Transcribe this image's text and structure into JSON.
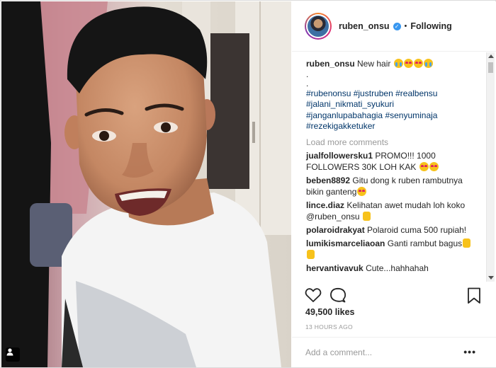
{
  "header": {
    "username": "ruben_onsu",
    "separator": "•",
    "follow_status": "Following",
    "verified_glyph": "✓"
  },
  "caption": {
    "username": "ruben_onsu",
    "text": "New hair",
    "emojis": [
      "crying-face",
      "heart-eyes-face",
      "heart-eyes-face",
      "crying-face"
    ],
    "dot_lines": [
      ".",
      "."
    ],
    "hashtags_line1": "#rubenonsu #justruben #realbensu",
    "hashtags_line2": "#jalani_nikmati_syukuri",
    "hashtags_line3": "#janganlupabahagia #senyuminaja",
    "hashtags_line4": "#rezekigakketuker"
  },
  "load_more": "Load more comments",
  "comments": [
    {
      "user": "jualfollowersku1",
      "text": "PROMO!!! 1000 FOLLOWERS 30K LOH KAK",
      "emojis": [
        "heart-eyes-face",
        "heart-eyes-face"
      ]
    },
    {
      "user": "beben8892",
      "text": "Gitu dong k ruben rambutnya bikin ganteng",
      "emojis": [
        "heart-eyes-face"
      ]
    },
    {
      "user": "lince.diaz",
      "text": "Kelihatan awet mudah loh koko @ruben_onsu",
      "emojis": [
        "thumbs-up"
      ]
    },
    {
      "user": "polaroidrakyat",
      "text": "Polaroid cuma 500 rupiah!",
      "emojis": []
    },
    {
      "user": "lumikismarceliaoan",
      "text": "Ganti rambut bagus",
      "emojis": [
        "thumbs-up",
        "thumbs-up"
      ]
    },
    {
      "user": "hervantivavuk",
      "text": "Cute...hahhahah",
      "emojis": []
    }
  ],
  "likes": "49,500 likes",
  "timestamp": "13 HOURS AGO",
  "add_comment_placeholder": "Add a comment...",
  "more_options": "•••",
  "icons": {
    "like": "heart-icon",
    "comment": "comment-icon",
    "save": "bookmark-icon",
    "tag": "user-tag-icon"
  },
  "colors": {
    "hashtag": "#003569",
    "verified": "#3897f0",
    "muted": "#999999"
  }
}
